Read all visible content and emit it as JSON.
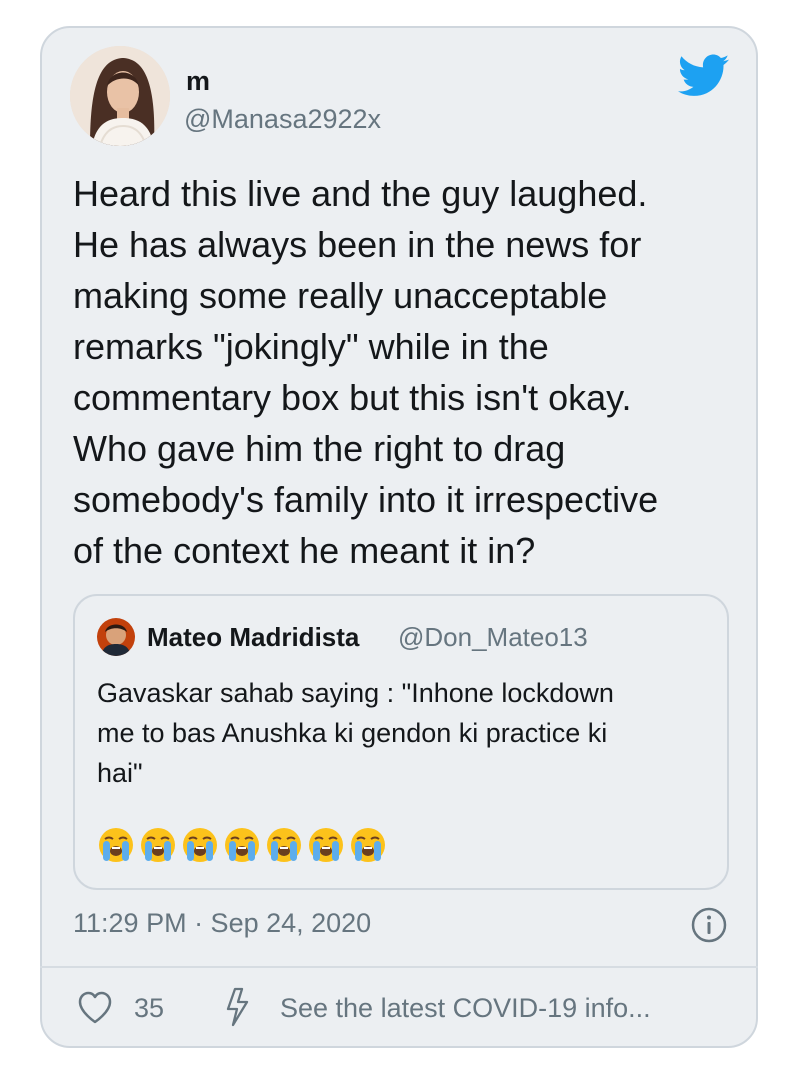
{
  "author": {
    "name": "m",
    "handle": "@Manasa2922x"
  },
  "tweet": {
    "lines": [
      "Heard this live and the guy laughed.",
      "He has always been in the news for",
      "making some really unacceptable",
      "remarks \"jokingly\" while in the",
      "commentary box but this isn't okay.",
      "Who gave him the right to drag",
      "somebody's family into it irrespective",
      "of the context he meant it in?"
    ]
  },
  "quoted_tweet": {
    "name": "Mateo Madridista",
    "handle": "@Don_Mateo13",
    "lines": [
      "Gavaskar sahab saying : \"Inhone lockdown",
      "me to bas Anushka ki gendon ki practice ki",
      "hai\""
    ],
    "emoji_icon": "loudly-crying-face-icon",
    "emoji_count": 7
  },
  "timestamp": "11:29 PM · Sep 24, 2020",
  "actions": {
    "like_count": "35",
    "covid_link": "See the latest COVID-19 info..."
  },
  "colors": {
    "card_bg": "#eceff2",
    "border": "#cfd6dd",
    "text": "#14171a",
    "secondary_text": "#66757f",
    "twitter_blue": "#1da1f2"
  }
}
